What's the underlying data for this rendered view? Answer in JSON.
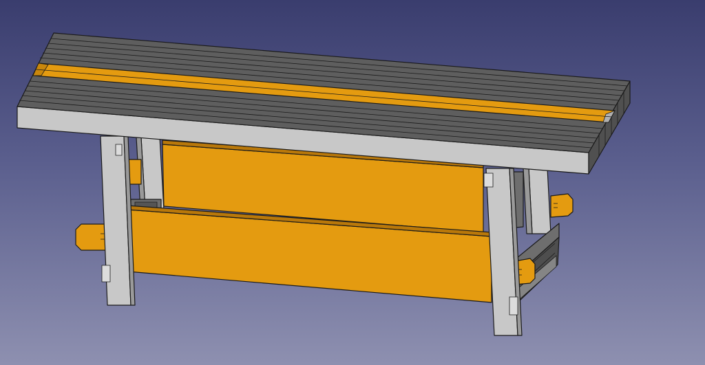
{
  "view": {
    "background_top": "#3a3d6e",
    "background_bottom": "#8e90b0"
  },
  "model": {
    "object": "workbench",
    "colors": {
      "frame": "#c8c8c8",
      "frame_shadow": "#8f8f8f",
      "top_boards": "#5e5e5e",
      "board_line": "#2a2a2a",
      "panel": "#e49b10",
      "panel_dark": "#b9780a",
      "stretcher": "#6e6e6e"
    }
  }
}
